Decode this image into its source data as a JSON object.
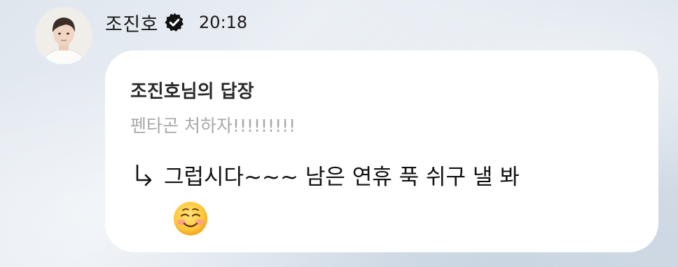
{
  "post": {
    "sender_name": "조진호",
    "time": "20:18",
    "reply_title": "조진호님의 답장",
    "quoted_text": "펜타곤 처하자!!!!!!!!!",
    "message_text": "그럽시다~~~ 남은 연휴 푹 쉬구 낼 봐",
    "icons": {
      "avatar": "profile-photo",
      "verified": "verified-badge-icon",
      "reply_arrow": "reply-arrow-icon",
      "emoji": "smiling-face-icon"
    }
  }
}
